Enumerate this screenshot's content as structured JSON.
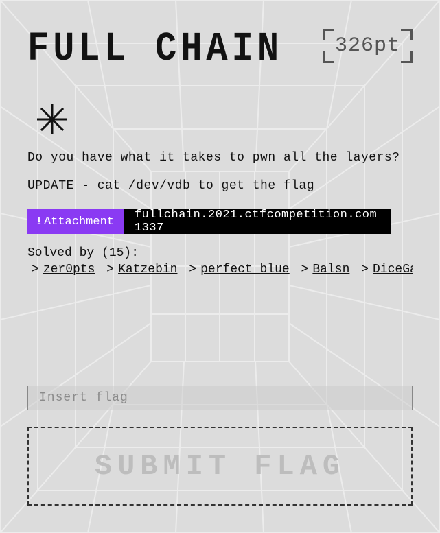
{
  "header": {
    "title": "FULL CHAIN",
    "points_label": "326pt"
  },
  "icon": {
    "name": "sparkle-icon"
  },
  "body": {
    "description": "Do you have what it takes to pwn all the layers?",
    "update": "UPDATE - cat /dev/vdb to get the flag"
  },
  "attachment": {
    "button_label": "Attachment",
    "host_port": "fullchain.2021.ctfcompetition.com 1337"
  },
  "solvers": {
    "label": "Solved by (15):",
    "teams": [
      "zer0pts",
      "Katzebin",
      "perfect blue",
      "Balsn",
      "DiceGang"
    ]
  },
  "flag_form": {
    "placeholder": "Insert flag",
    "submit_label": "SUBMIT FLAG"
  }
}
